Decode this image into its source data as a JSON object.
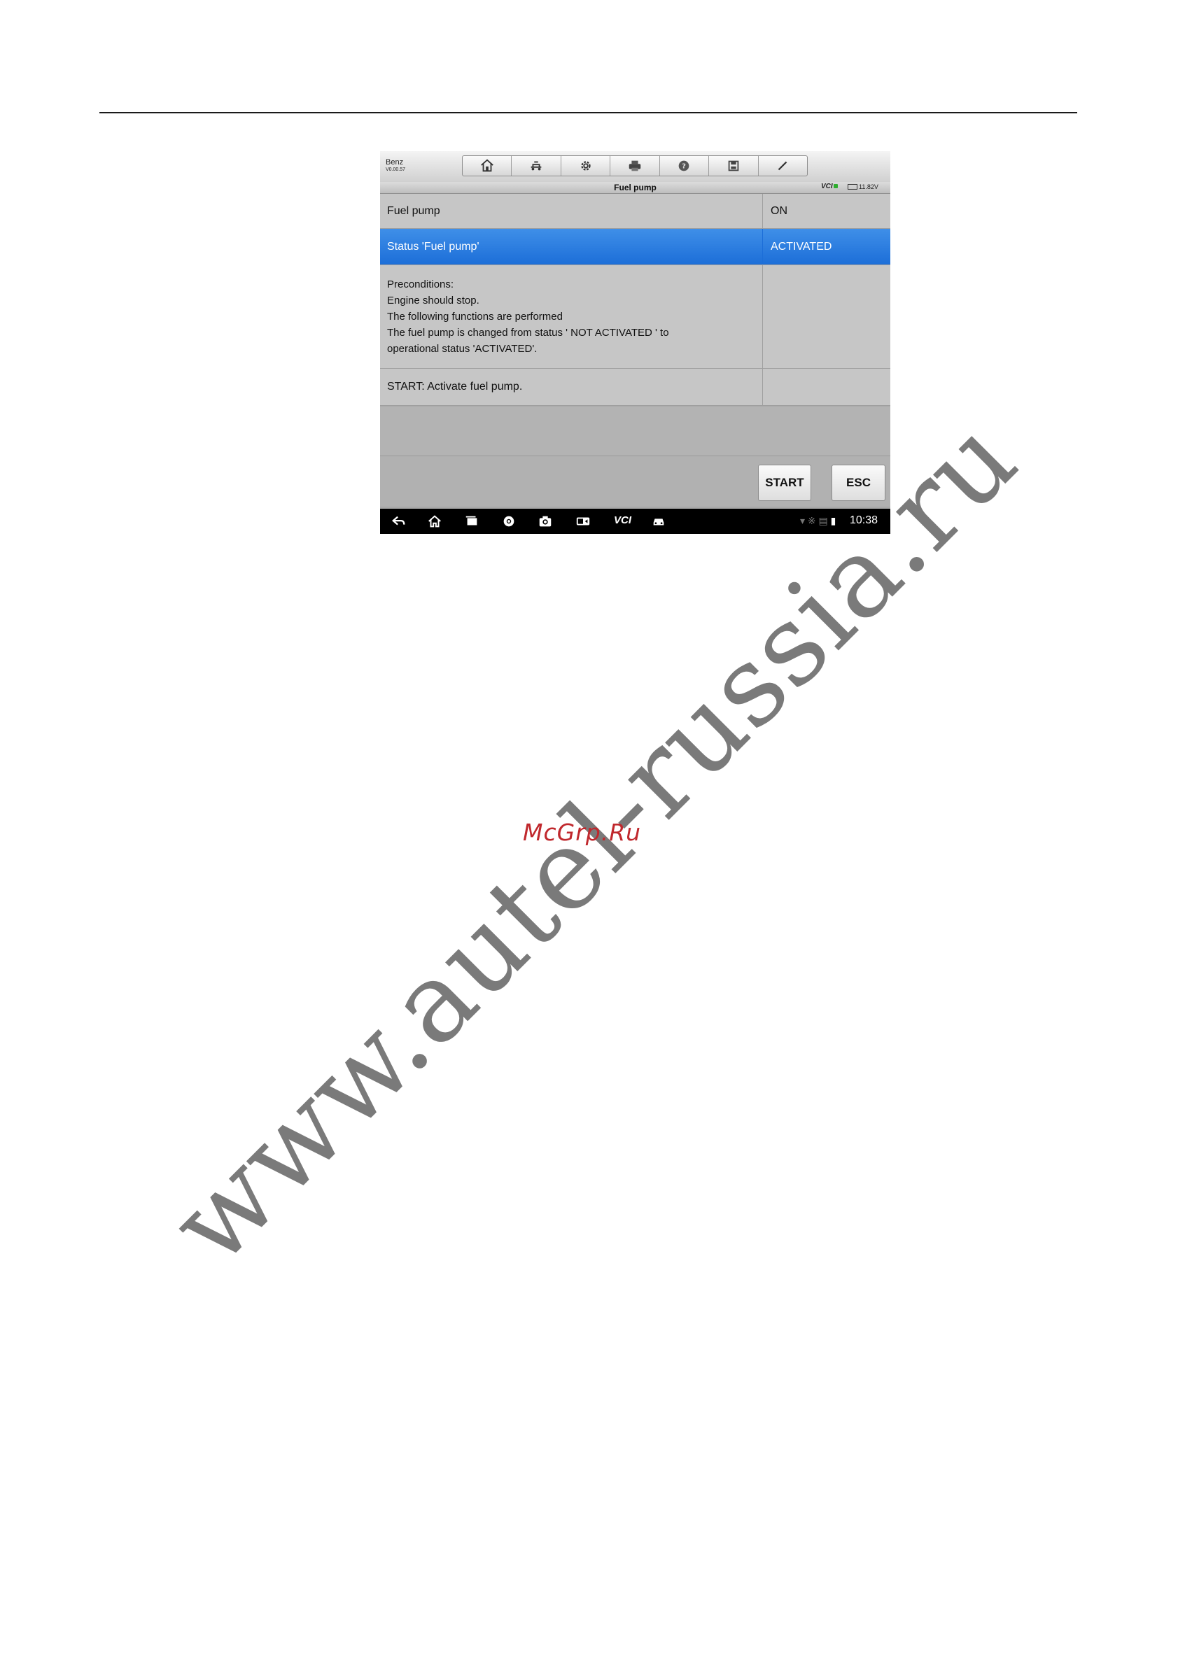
{
  "device": {
    "brand": "Benz",
    "version": "V0.00.57",
    "toolbar": [
      "home-icon",
      "vehicle-swap-icon",
      "gear-icon",
      "printer-icon",
      "help-icon",
      "save-icon",
      "pen-icon"
    ],
    "screen_title": "Fuel pump",
    "vci_label": "VCI",
    "voltage": "11.82V",
    "rows": [
      {
        "label": "Fuel pump",
        "value": "ON",
        "selected": false
      },
      {
        "label": "Status 'Fuel pump'",
        "value": "ACTIVATED",
        "selected": true
      },
      {
        "label_lines": [
          "Preconditions:",
          "Engine should stop.",
          "The following functions are performed",
          "The fuel pump is changed from status ' NOT ACTIVATED ' to",
          "operational status 'ACTIVATED'."
        ],
        "value": ""
      },
      {
        "label": "START: Activate fuel pump.",
        "value": ""
      }
    ],
    "buttons": {
      "start": "START",
      "esc": "ESC"
    },
    "navbar": {
      "icons": [
        "back-icon",
        "home-icon",
        "recent-apps-icon",
        "browser-icon",
        "camera-icon",
        "screen-capture-icon",
        "vci-icon",
        "car-icon"
      ],
      "vci_label": "VCI",
      "time": "10:38"
    },
    "selected_color": "#1c6ed8"
  },
  "watermark": "www.autel-russia.ru",
  "stamp": "McGrp.Ru"
}
